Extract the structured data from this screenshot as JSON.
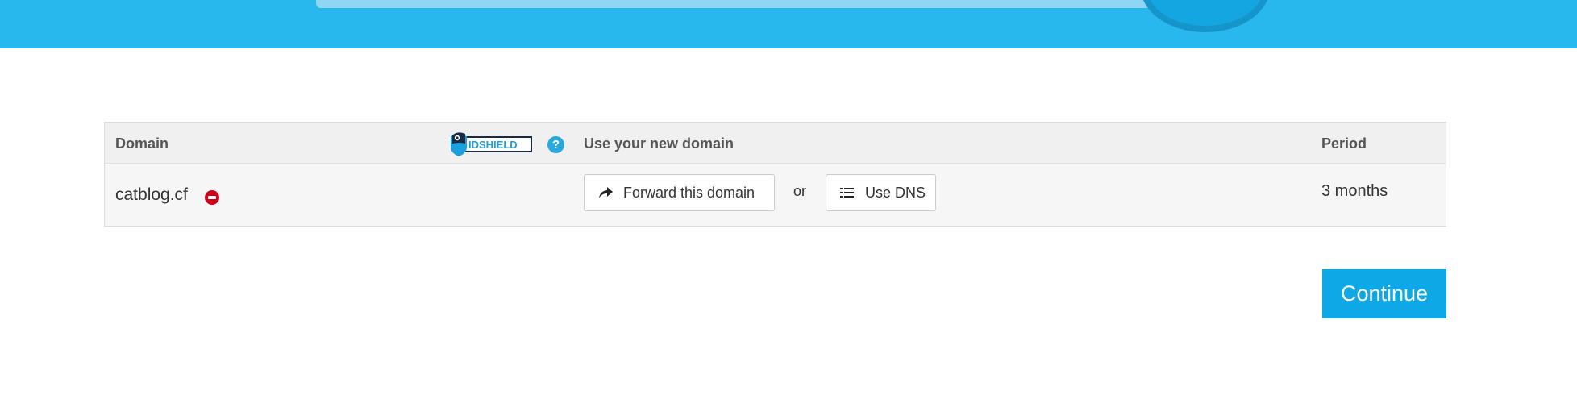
{
  "table": {
    "headers": {
      "domain": "Domain",
      "use": "Use your new domain",
      "period": "Period"
    },
    "idshield_logo": {
      "icon": "idshield-logo",
      "text": "IDSHIELD"
    },
    "help_icon": {
      "icon": "question-circle-icon",
      "glyph": "?"
    },
    "rows": [
      {
        "domain": "catblog.cf",
        "remove_icon": "remove-circle-icon",
        "forward_label": "Forward this domain",
        "or_label": "or",
        "dns_label": "Use DNS",
        "period": "3 months"
      }
    ]
  },
  "continue_label": "Continue",
  "colors": {
    "header_band": "#29b8ed",
    "accent": "#0ea8e6",
    "remove": "#d0021b",
    "help": "#29a8e0"
  }
}
